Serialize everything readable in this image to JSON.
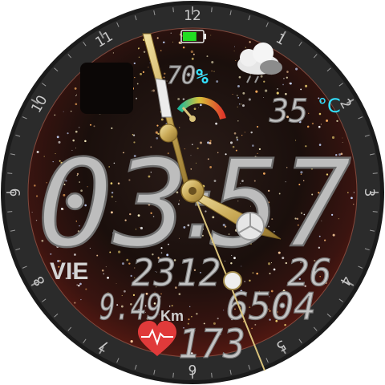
{
  "watchface": {
    "bezel_numbers": [
      "12",
      "1",
      "2",
      "3",
      "4",
      "5",
      "6",
      "7",
      "8",
      "9",
      "10",
      "11"
    ],
    "time": {
      "hours": "03",
      "minutes": "57"
    },
    "battery": {
      "percent": "70%",
      "level": 0.7,
      "color": "#22dd22"
    },
    "weather": {
      "temperature": "35",
      "unit": "°C",
      "icon": "cloud-rain-icon"
    },
    "date": {
      "day_of_week": "VIE",
      "day": "23",
      "month": "12",
      "year": "26"
    },
    "distance": {
      "value": "9.49",
      "unit": "Km"
    },
    "steps": "6504",
    "heart_rate": {
      "value": "173",
      "icon": "heart-icon"
    },
    "accent_colors": {
      "cyan": "#33e0ff",
      "gold": "#d9c27a",
      "heart": "#e03a3a"
    }
  }
}
